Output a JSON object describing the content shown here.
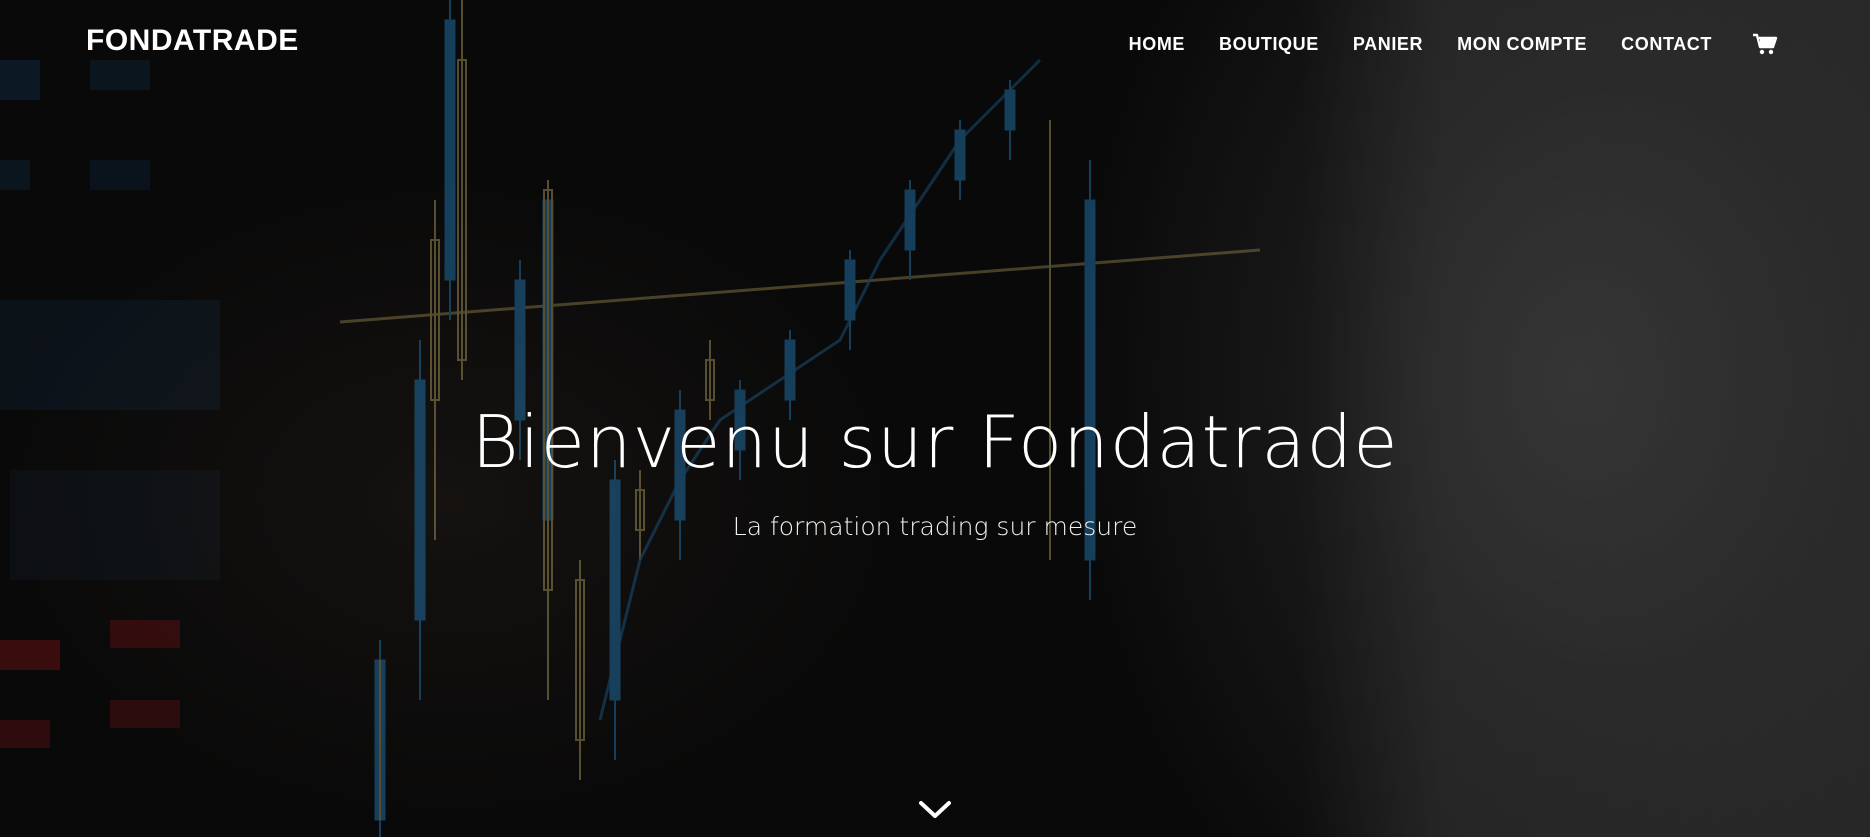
{
  "header": {
    "brand": "FONDATRADE",
    "nav": [
      {
        "label": "HOME"
      },
      {
        "label": "BOUTIQUE"
      },
      {
        "label": "PANIER"
      },
      {
        "label": "MON COMPTE"
      },
      {
        "label": "CONTACT"
      }
    ],
    "cart_icon": "shopping-cart-icon"
  },
  "hero": {
    "title": "Bienvenu sur Fondatrade",
    "subtitle": "La formation trading sur mesure",
    "scroll_icon": "chevron-down-icon"
  },
  "colors": {
    "text": "#ffffff",
    "background": "#0d0c0c",
    "chart_blue": "#2a8fd4",
    "chart_gold": "#c8b46a",
    "chart_red": "#c0262b"
  }
}
